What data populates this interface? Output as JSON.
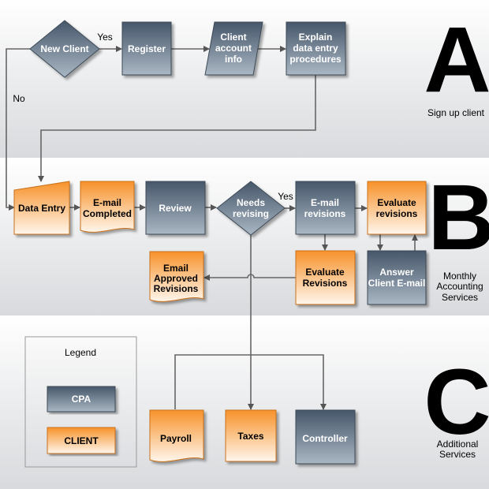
{
  "colors": {
    "cpa": "#4a5a6c",
    "client": "#f7992f",
    "line": "#666666"
  },
  "sections": [
    {
      "letter": "A",
      "caption": [
        "Sign up client"
      ]
    },
    {
      "letter": "B",
      "caption": [
        "Monthly",
        "Accounting",
        "Services"
      ]
    },
    {
      "letter": "C",
      "caption": [
        "Additional",
        "Services"
      ]
    }
  ],
  "nodes": {
    "new_client": [
      "New Client"
    ],
    "register": [
      "Register"
    ],
    "client_account_info": [
      "Client",
      "account",
      "info"
    ],
    "explain": [
      "Explain",
      "data entry",
      "procedures"
    ],
    "data_entry": [
      "Data Entry"
    ],
    "email_completed": [
      "E-mail",
      "Completed"
    ],
    "review": [
      "Review"
    ],
    "needs_revising": [
      "Needs",
      "revising"
    ],
    "email_revisions": [
      "E-mail",
      "revisions"
    ],
    "evaluate_revisions_client": [
      "Evaluate",
      "revisions"
    ],
    "evaluate_revisions": [
      "Evaluate",
      "Revisions"
    ],
    "answer_client_email": [
      "Answer",
      "Client E-mail"
    ],
    "email_approved": [
      "Email",
      "Approved",
      "Revisions"
    ],
    "payroll": [
      "Payroll"
    ],
    "taxes": [
      "Taxes"
    ],
    "controller": [
      "Controller"
    ]
  },
  "edge_labels": {
    "yes1": "Yes",
    "no": "No",
    "yes2": "Yes"
  },
  "legend": {
    "title": "Legend",
    "cpa": "CPA",
    "client": "CLIENT"
  }
}
